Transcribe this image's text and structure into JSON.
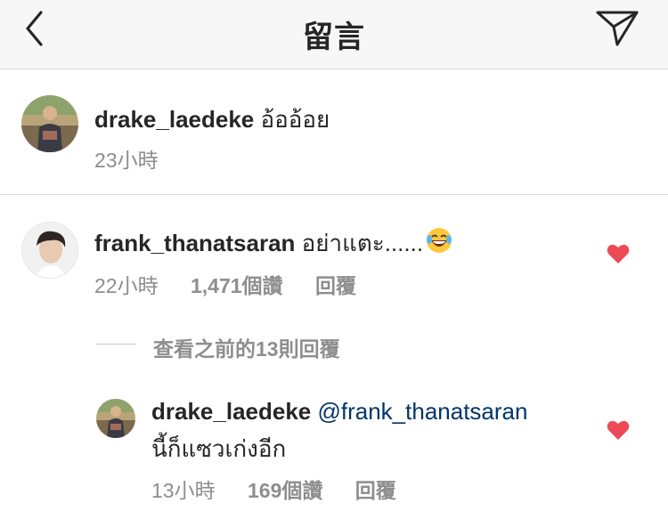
{
  "header": {
    "title": "留言",
    "back_icon": "chevron-left-icon",
    "send_icon": "paper-plane-icon"
  },
  "caption": {
    "username": "drake_laedeke",
    "text": "อ้ออ้อย",
    "time": "23小時"
  },
  "comment": {
    "username": "frank_thanatsaran",
    "text": "อย่าแตะ......",
    "emoji": "laughing-with-tears-emoji",
    "time": "22小時",
    "likes": "1,471個讚",
    "reply_label": "回覆",
    "liked": true
  },
  "view_replies": {
    "label": "查看之前的13則回覆"
  },
  "reply": {
    "username": "drake_laedeke",
    "mention": "@frank_thanatsaran",
    "text": "นี้ก็แซวเก่งอีก",
    "time": "13小時",
    "likes": "169個讚",
    "reply_label": "回覆",
    "liked": true
  },
  "colors": {
    "heart": "#ed4956",
    "mention": "#003569",
    "muted": "#8e8e8e",
    "divider": "#dbdbdb",
    "header_bg": "#f7f7f7"
  }
}
